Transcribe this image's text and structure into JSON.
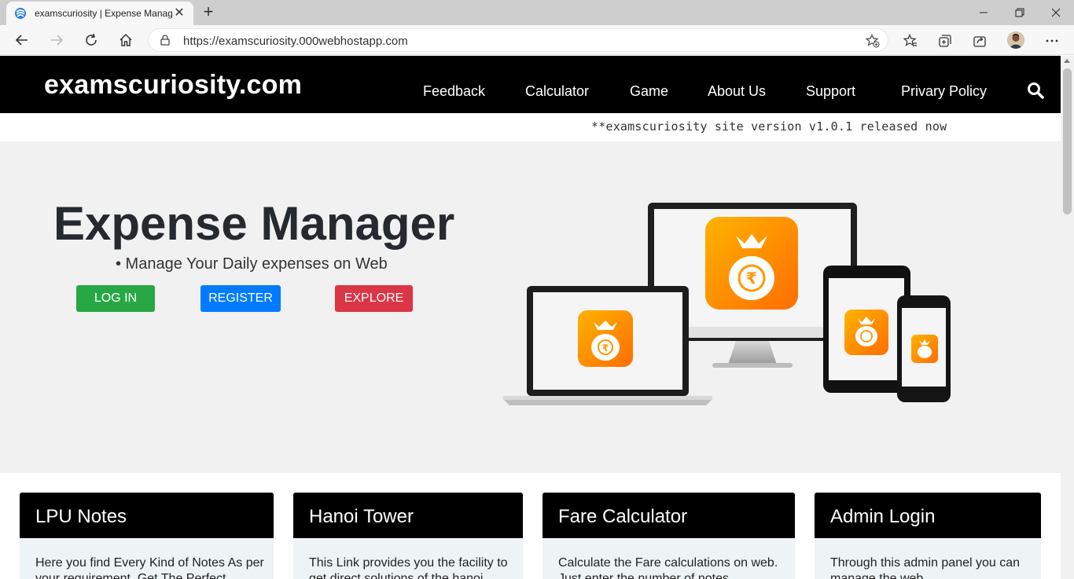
{
  "browser": {
    "tab_title": "examscuriosity | Expense Manager",
    "url": "https://examscuriosity.000webhostapp.com"
  },
  "site": {
    "brand": "examscuriosity.com",
    "nav": [
      "Feedback",
      "Calculator",
      "Game",
      "About Us",
      "Support",
      "Privary Policy"
    ],
    "announcement": "**examscuriosity site version v1.0.1 released now"
  },
  "hero": {
    "title": "Expense Manager",
    "subtitle": "• Manage Your Daily expenses on Web",
    "login": "LOG IN",
    "register": "REGISTER",
    "explore": "EXPLORE"
  },
  "cards": [
    {
      "title": "LPU Notes",
      "body": "Here you find Every Kind of Notes As per your requirement. Get The Perfect"
    },
    {
      "title": "Hanoi Tower",
      "body": "This Link provides you the facility to get direct solutions of the hanoi"
    },
    {
      "title": "Fare Calculator",
      "body": "Calculate the Fare calculations on web. Just enter the number of notes"
    },
    {
      "title": "Admin Login",
      "body": "Through this admin panel you can manage the web"
    }
  ],
  "colors": {
    "login": "#28a745",
    "register": "#007bff",
    "explore": "#dc3545",
    "navbar": "#000000",
    "hero_bg": "#f1f1f1"
  }
}
